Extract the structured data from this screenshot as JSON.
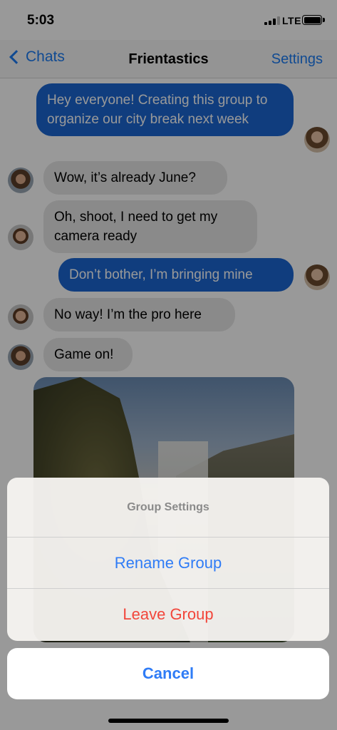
{
  "status_bar": {
    "time": "5:03",
    "network": "LTE"
  },
  "nav": {
    "back_label": "Chats",
    "title": "Frientastics",
    "settings_label": "Settings"
  },
  "messages": [
    {
      "direction": "outgoing",
      "text": "Hey everyone! Creating this group to organize our city break next week",
      "avatar": "woman-avatar"
    },
    {
      "direction": "incoming",
      "text": "Wow, it’s already June?",
      "avatar": "woman-avatar"
    },
    {
      "direction": "incoming",
      "text": "Oh, shoot, I need to get my camera ready",
      "avatar": "man-avatar"
    },
    {
      "direction": "outgoing",
      "text": "Don’t bother, I’m bringing mine",
      "avatar": "woman-avatar"
    },
    {
      "direction": "incoming",
      "text": "No way! I’m the pro here",
      "avatar": "man-avatar"
    },
    {
      "direction": "incoming",
      "text": "Game on!",
      "avatar": "woman-avatar"
    }
  ],
  "photo_message": {
    "description_icon": "waterfall-photo"
  },
  "action_sheet": {
    "title": "Group Settings",
    "rename_label": "Rename Group",
    "leave_label": "Leave Group",
    "cancel_label": "Cancel"
  },
  "colors": {
    "accent": "#2f7cf6",
    "outgoing_bubble": "#1b66d2",
    "incoming_bubble": "#e6e6e6",
    "destructive": "#f2463b"
  }
}
